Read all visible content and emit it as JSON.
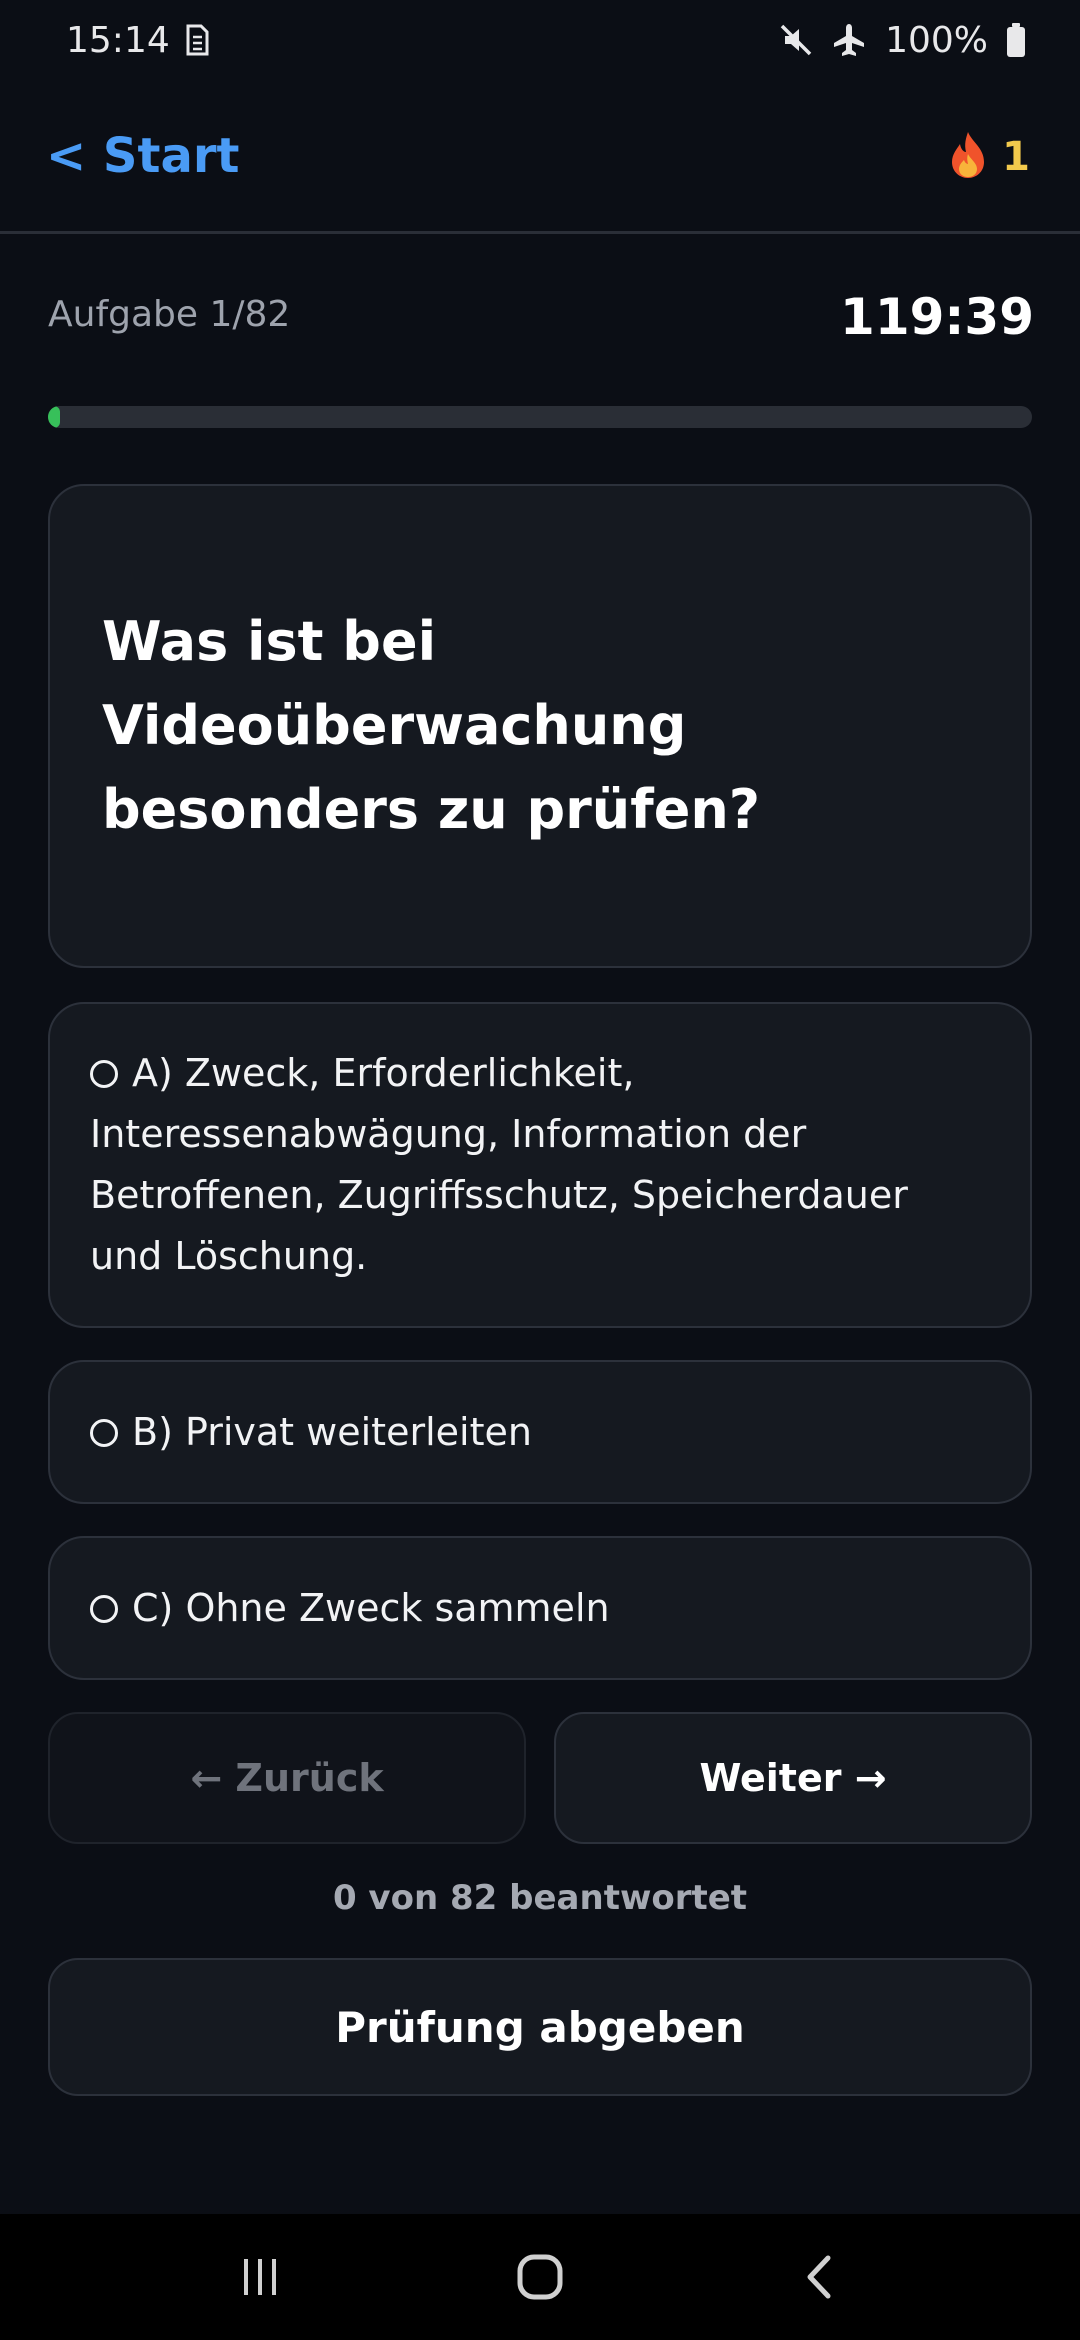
{
  "status_bar": {
    "time": "15:14",
    "battery": "100%",
    "icons": [
      "sim-icon",
      "mute-icon",
      "airplane-icon",
      "battery-icon"
    ]
  },
  "header": {
    "back_label": "< Start",
    "streak_count": "1",
    "streak_icon": "fire-icon"
  },
  "quiz": {
    "task_label": "Aufgabe 1/82",
    "timer": "119:39",
    "progress_fraction": 0.012,
    "question": "Was ist bei Videoüberwachung besonders zu prüfen?",
    "options": [
      {
        "label": "A) Zweck, Erforderlichkeit, Interessenabwägung, Information der Betroffenen, Zugriffsschutz, Speicherdauer und Löschung."
      },
      {
        "label": "B) Privat weiterleiten"
      },
      {
        "label": "C) Ohne Zweck sammeln"
      }
    ]
  },
  "navigation": {
    "back_label": "← Zurück",
    "next_label": "Weiter →",
    "answered_text": "0 von 82 beantwortet",
    "submit_label": "Prüfung abgeben"
  },
  "colors": {
    "background": "#0b0e15",
    "card": "#151920",
    "accent_link": "#4a9bf5",
    "progress_fill": "#37c05a",
    "streak": "#f2c94c"
  }
}
